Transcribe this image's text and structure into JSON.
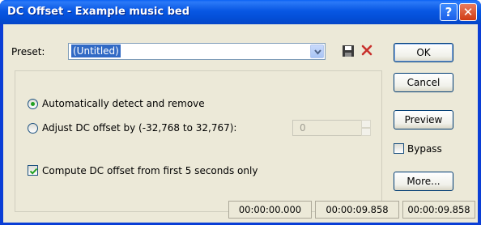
{
  "window": {
    "title": "DC Offset - Example music bed",
    "help_glyph": "?",
    "close_glyph": "✕"
  },
  "preset": {
    "label": "Preset:",
    "value": "(Untitled)"
  },
  "buttons": {
    "ok": "OK",
    "cancel": "Cancel",
    "preview": "Preview",
    "more": "More..."
  },
  "bypass": {
    "label": "Bypass",
    "checked": false
  },
  "options": {
    "auto_detect": {
      "label": "Automatically detect and remove",
      "selected": true
    },
    "adjust": {
      "label": "Adjust DC offset by (-32,768 to 32,767):",
      "selected": false,
      "value": "0"
    },
    "compute_first": {
      "label": "Compute DC offset from first 5 seconds only",
      "checked": true
    }
  },
  "status_bar": {
    "start": "00:00:00.000",
    "end": "00:00:09.858",
    "length": "00:00:09.858"
  },
  "colors": {
    "titlebar": "#0a5ce6",
    "selection": "#316ac5",
    "delete_icon": "#c8302c",
    "radio_dot": "#21a121"
  },
  "icons": [
    "help-icon",
    "close-icon",
    "chevron-down-icon",
    "save-icon",
    "delete-icon",
    "checkmark-icon"
  ]
}
